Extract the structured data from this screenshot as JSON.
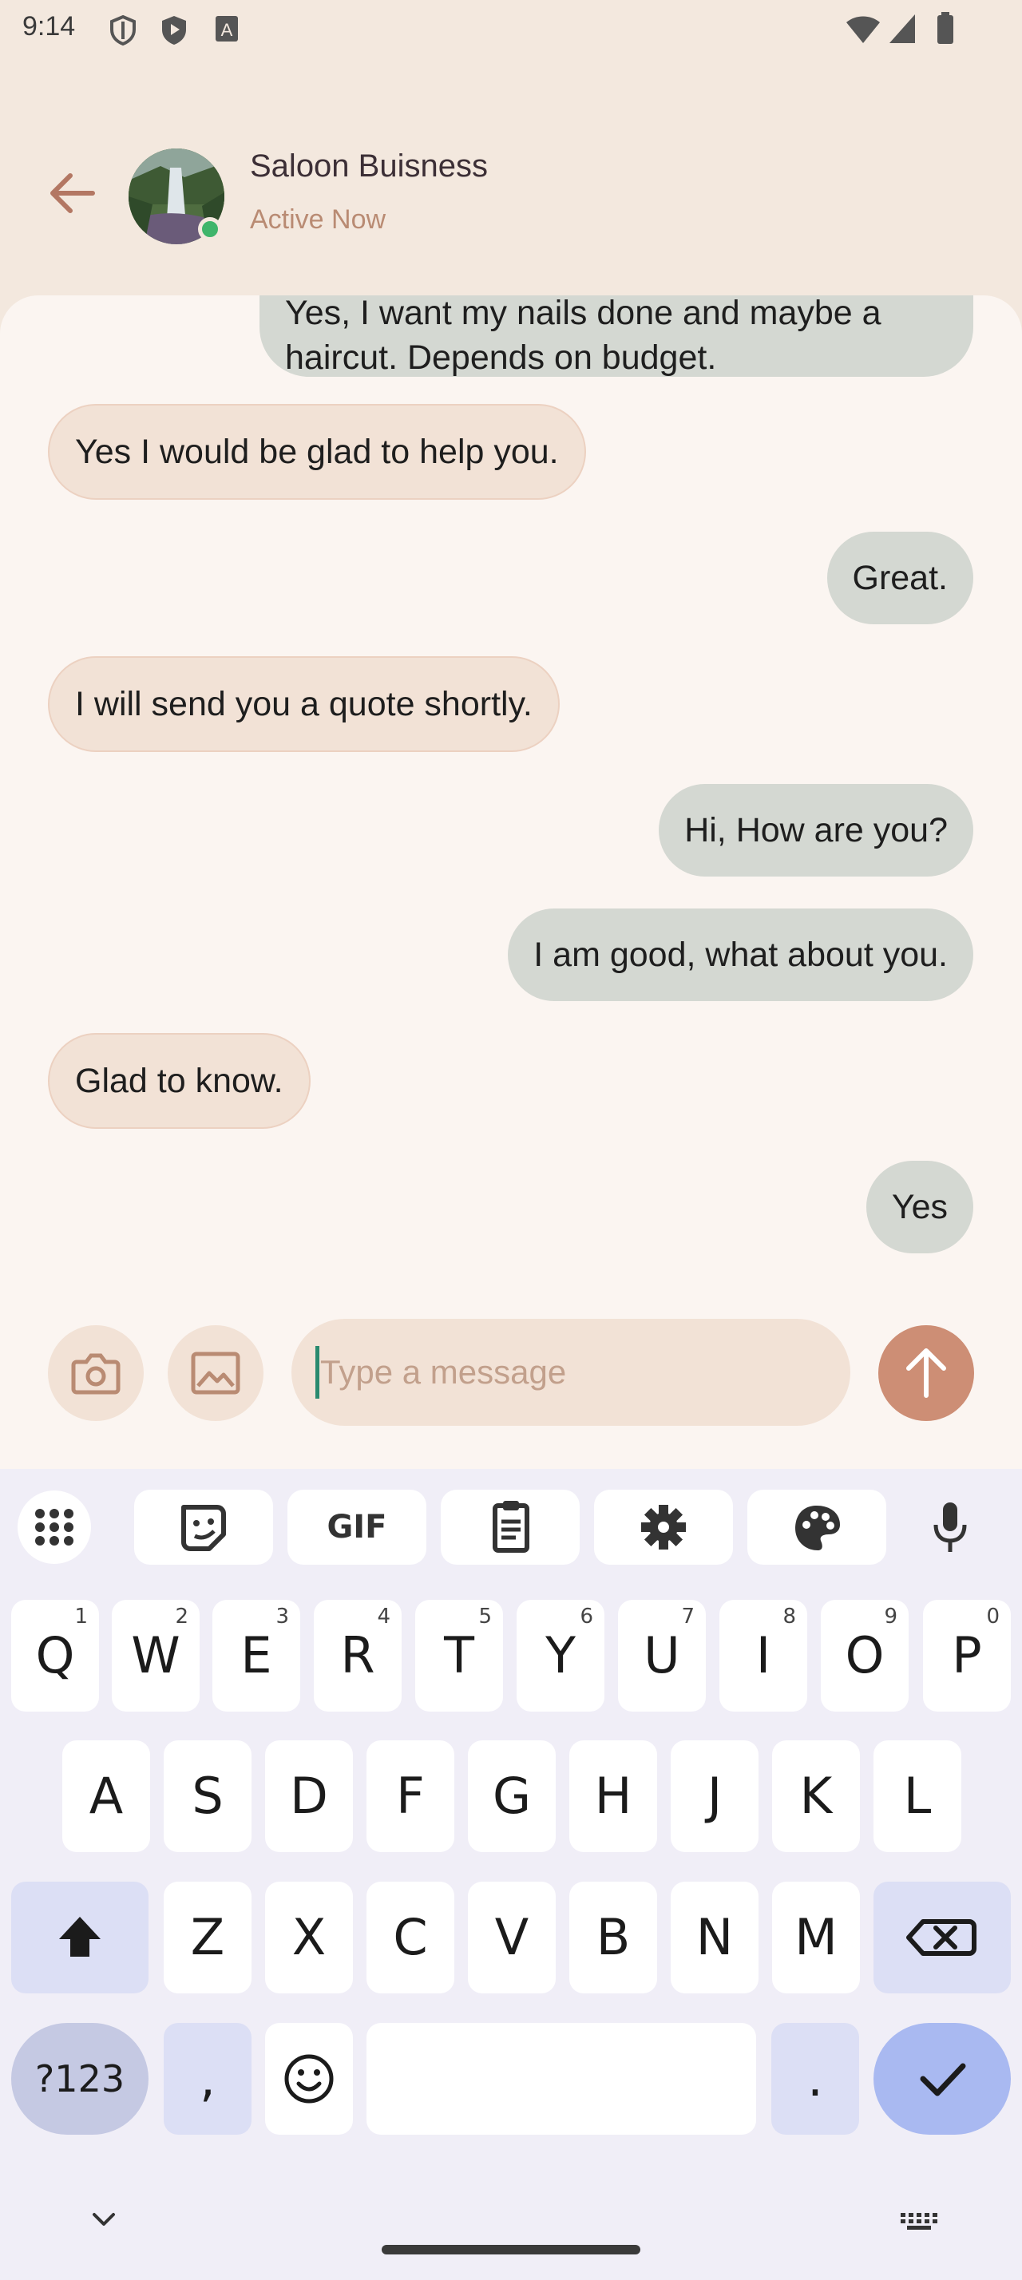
{
  "status_bar": {
    "time": "9:14"
  },
  "header": {
    "name": "Saloon Buisness",
    "status": "Active Now"
  },
  "messages": [
    {
      "direction": "out",
      "text": "Yes, I want my nails done and maybe a haircut. Depends on budget."
    },
    {
      "direction": "in",
      "text": "Yes I would be glad to help you."
    },
    {
      "direction": "out",
      "text": "Great."
    },
    {
      "direction": "in",
      "text": "I will send you a quote shortly."
    },
    {
      "direction": "out",
      "text": "Hi, How are you?"
    },
    {
      "direction": "out",
      "text": "I am good, what about you."
    },
    {
      "direction": "in",
      "text": "Glad to know."
    },
    {
      "direction": "out",
      "text": "Yes"
    }
  ],
  "composer": {
    "placeholder": "Type a message"
  },
  "keyboard": {
    "gif_label": "GIF",
    "row1": [
      {
        "key": "Q",
        "sup": "1"
      },
      {
        "key": "W",
        "sup": "2"
      },
      {
        "key": "E",
        "sup": "3"
      },
      {
        "key": "R",
        "sup": "4"
      },
      {
        "key": "T",
        "sup": "5"
      },
      {
        "key": "Y",
        "sup": "6"
      },
      {
        "key": "U",
        "sup": "7"
      },
      {
        "key": "I",
        "sup": "8"
      },
      {
        "key": "O",
        "sup": "9"
      },
      {
        "key": "P",
        "sup": "0"
      }
    ],
    "row2": [
      "A",
      "S",
      "D",
      "F",
      "G",
      "H",
      "J",
      "K",
      "L"
    ],
    "row3": [
      "Z",
      "X",
      "C",
      "V",
      "B",
      "N",
      "M"
    ],
    "symbols_label": "?123",
    "comma": ",",
    "period": "."
  },
  "colors": {
    "accent": "#cd8e75",
    "incoming_bubble": "#f2e2d6",
    "outgoing_bubble": "#d4d8d2",
    "online": "#3fb56b"
  }
}
